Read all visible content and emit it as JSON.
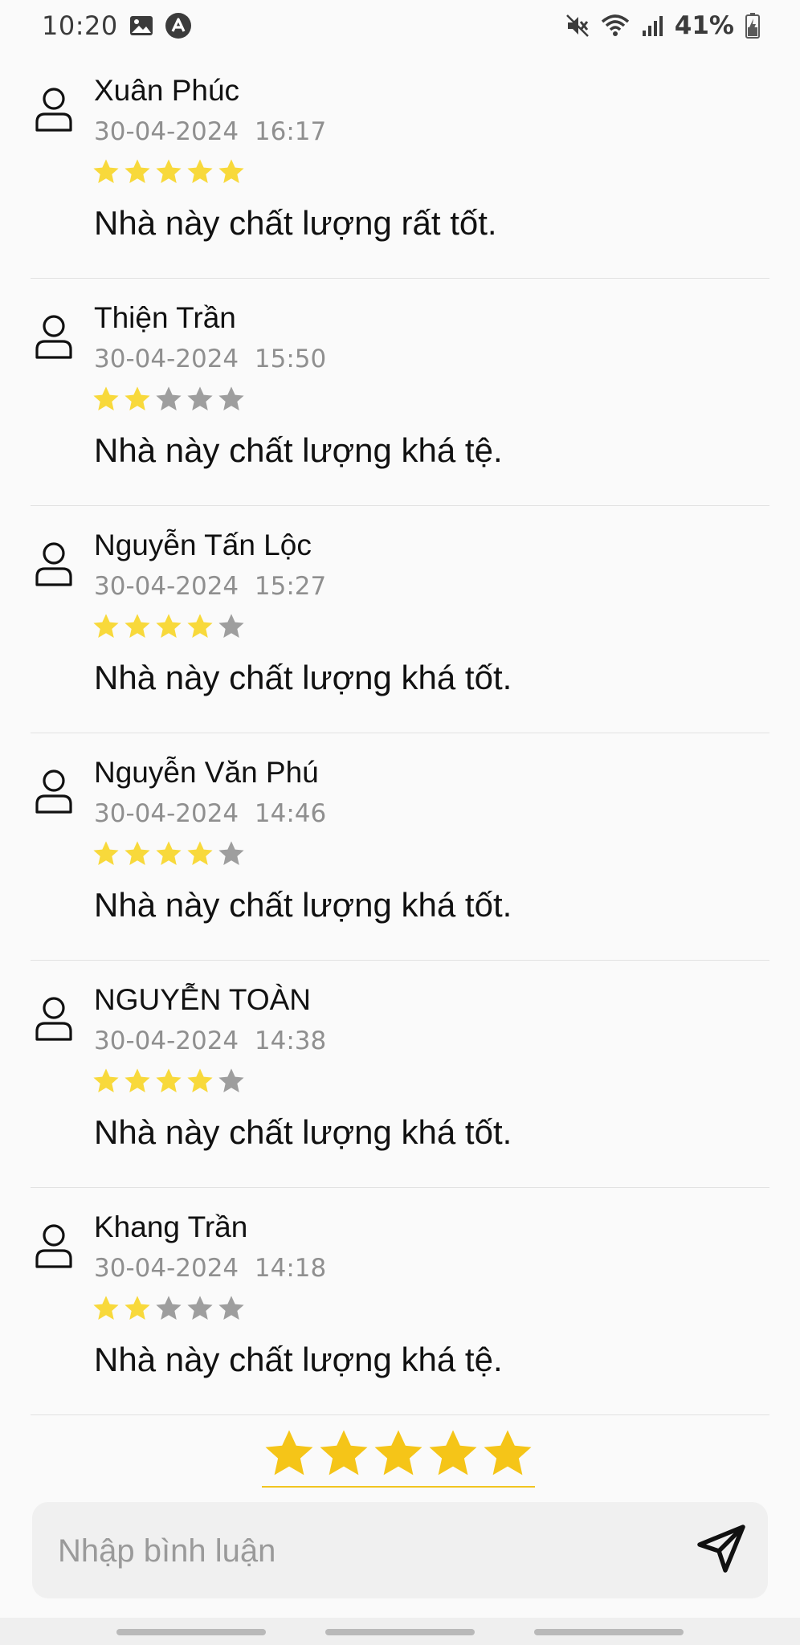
{
  "status_bar": {
    "time": "10:20",
    "battery": "41%",
    "icons": [
      "gallery-icon",
      "app-notification-icon",
      "mute-icon",
      "wifi-icon",
      "signal-icon",
      "battery-icon"
    ]
  },
  "colors": {
    "star_on": "#F8D93B",
    "star_off": "#9E9E9E",
    "star_large": "#F5C518",
    "divider": "#E2E2E2"
  },
  "reviews": [
    {
      "name": "Xuân Phúc",
      "date": "30-04-2024",
      "time": "16:17",
      "rating": 5,
      "text": "Nhà này chất lượng rất tốt."
    },
    {
      "name": "Thiện Trần",
      "date": "30-04-2024",
      "time": "15:50",
      "rating": 2,
      "text": "Nhà này chất lượng khá tệ."
    },
    {
      "name": "Nguyễn Tấn Lộc",
      "date": "30-04-2024",
      "time": "15:27",
      "rating": 4,
      "text": "Nhà này chất lượng khá tốt."
    },
    {
      "name": "Nguyễn Văn Phú",
      "date": "30-04-2024",
      "time": "14:46",
      "rating": 4,
      "text": "Nhà này chất lượng khá tốt."
    },
    {
      "name": "NGUYỄN TOÀN",
      "date": "30-04-2024",
      "time": "14:38",
      "rating": 4,
      "text": "Nhà này chất lượng khá tốt."
    },
    {
      "name": "Khang Trần",
      "date": "30-04-2024",
      "time": "14:18",
      "rating": 2,
      "text": "Nhà này chất lượng khá tệ."
    }
  ],
  "rating_input": {
    "value": 5,
    "max": 5
  },
  "comment": {
    "placeholder": "Nhập bình luận",
    "value": ""
  }
}
